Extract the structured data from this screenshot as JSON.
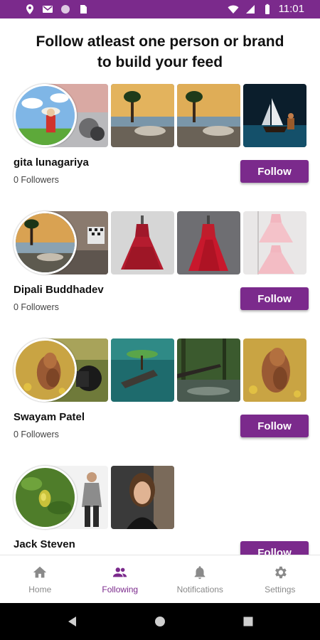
{
  "status_bar": {
    "time": "11:01",
    "background": "#7b2a8c"
  },
  "heading": {
    "line1": "Follow atleast one person or brand",
    "line2": "to build your feed"
  },
  "accent_color": "#7b2a8c",
  "users": [
    {
      "name": "gita lunagariya",
      "followers": "0 Followers",
      "button": "Follow"
    },
    {
      "name": "Dipali Buddhadev",
      "followers": "0 Followers",
      "button": "Follow"
    },
    {
      "name": "Swayam Patel",
      "followers": "0 Followers",
      "button": "Follow"
    },
    {
      "name": "Jack Steven",
      "followers": "",
      "button": "Follow"
    }
  ],
  "bottom_nav": {
    "items": [
      {
        "label": "Home",
        "icon": "home-icon",
        "active": false
      },
      {
        "label": "Following",
        "icon": "people-icon",
        "active": true
      },
      {
        "label": "Notifications",
        "icon": "bell-icon",
        "active": false
      },
      {
        "label": "Settings",
        "icon": "gear-icon",
        "active": false
      }
    ]
  },
  "system_nav": {
    "icons": [
      "back-icon",
      "home-circle-icon",
      "recents-icon"
    ]
  }
}
